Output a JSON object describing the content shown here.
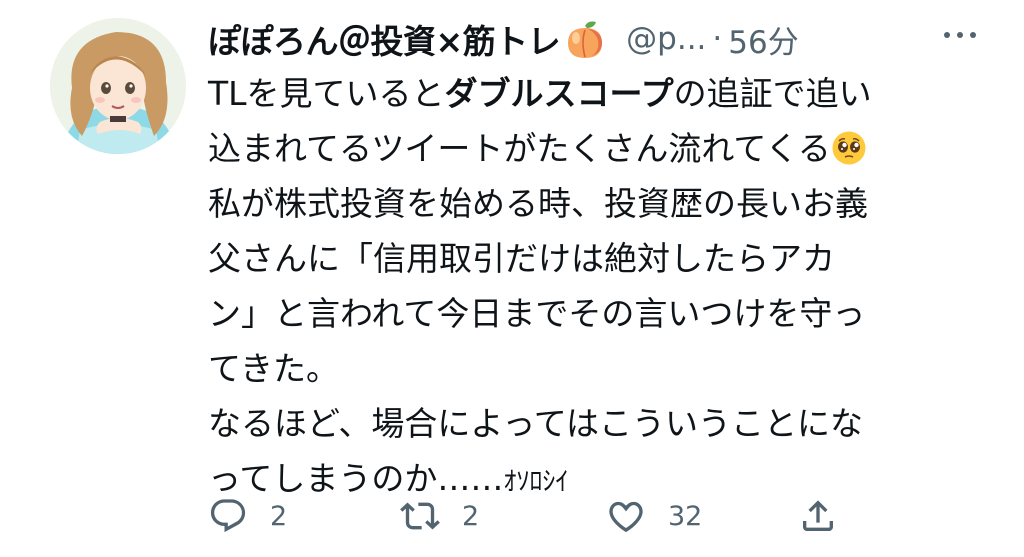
{
  "user": {
    "display_name": "ぽぽろん＠投資×筋トレ",
    "name_emoji": "peach-icon",
    "handle": "@p...",
    "separator": "·",
    "time": "56分"
  },
  "tweet": {
    "lines": [
      {
        "a": "TLを見ていると",
        "b": "ダブルスコープ",
        "c": "の追証で追い"
      },
      {
        "a": "込まれてるツイートがたくさん流れてくる"
      },
      {
        "a": "私が株式投資を始める時、投資歴の長いお義"
      },
      {
        "a": "父さんに「信用取引だけは絶対したらアカ"
      },
      {
        "a": "ン」と言われて今日までその言いつけを守っ"
      },
      {
        "a": "てきた。"
      },
      {
        "a": "なるほど、場合によってはこういうことにな"
      },
      {
        "a": "ってしまうのか……",
        "b": "ｵｿﾛｼｲ"
      }
    ],
    "emoji": "pleading-face-icon"
  },
  "actions": {
    "reply_count": "2",
    "retweet_count": "2",
    "like_count": "32"
  },
  "colors": {
    "text": "#0f1419",
    "secondary": "#536471",
    "background": "#ffffff"
  }
}
